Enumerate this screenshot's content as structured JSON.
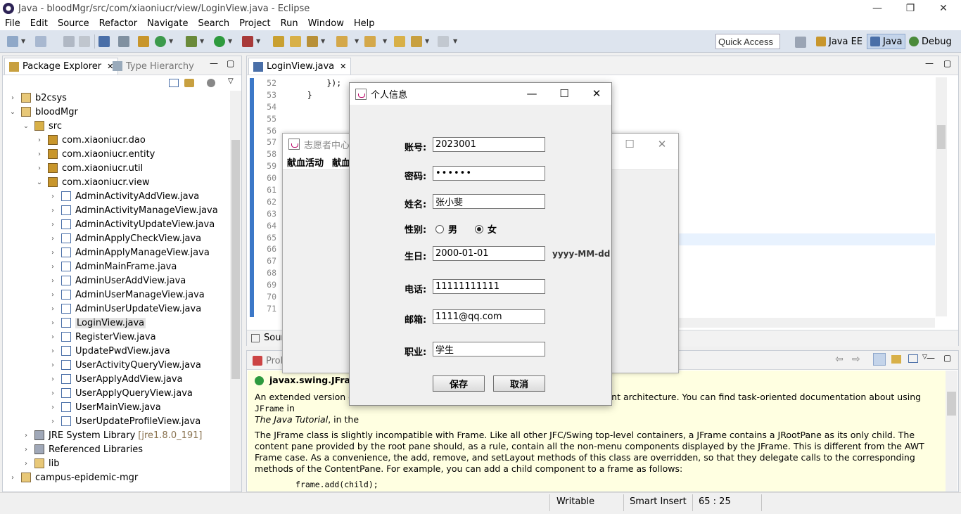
{
  "window": {
    "title": "Java - bloodMgr/src/com/xiaoniucr/view/LoginView.java - Eclipse",
    "minimize": "—",
    "restore": "❐",
    "close": "✕"
  },
  "menubar": [
    "File",
    "Edit",
    "Source",
    "Refactor",
    "Navigate",
    "Search",
    "Project",
    "Run",
    "Window",
    "Help"
  ],
  "toolbar": {
    "quick_access": "Quick Access",
    "perspectives": [
      {
        "label": "Java EE",
        "icon": "java-ee-perspective-icon"
      },
      {
        "label": "Java",
        "icon": "java-perspective-icon"
      },
      {
        "label": "Debug",
        "icon": "debug-perspective-icon"
      }
    ]
  },
  "package_explorer": {
    "tab_label": "Package Explorer",
    "tab2_label": "Type Hierarchy",
    "tree": [
      {
        "label": "b2csys",
        "arrow": "›",
        "icon": "project-icon",
        "depth": 0
      },
      {
        "label": "bloodMgr",
        "arrow": "⌄",
        "icon": "project-icon",
        "depth": 0
      },
      {
        "label": "src",
        "arrow": "⌄",
        "icon": "source-folder-icon",
        "depth": 1
      },
      {
        "label": "com.xiaoniucr.dao",
        "arrow": "›",
        "icon": "package-icon",
        "depth": 2
      },
      {
        "label": "com.xiaoniucr.entity",
        "arrow": "›",
        "icon": "package-icon",
        "depth": 2
      },
      {
        "label": "com.xiaoniucr.util",
        "arrow": "›",
        "icon": "package-icon",
        "depth": 2
      },
      {
        "label": "com.xiaoniucr.view",
        "arrow": "⌄",
        "icon": "package-icon",
        "depth": 2
      },
      {
        "label": "AdminActivityAddView.java",
        "arrow": "›",
        "icon": "java-file-icon",
        "depth": 3
      },
      {
        "label": "AdminActivityManageView.java",
        "arrow": "›",
        "icon": "java-file-icon",
        "depth": 3
      },
      {
        "label": "AdminActivityUpdateView.java",
        "arrow": "›",
        "icon": "java-file-icon",
        "depth": 3
      },
      {
        "label": "AdminApplyCheckView.java",
        "arrow": "›",
        "icon": "java-file-icon",
        "depth": 3
      },
      {
        "label": "AdminApplyManageView.java",
        "arrow": "›",
        "icon": "java-file-icon",
        "depth": 3
      },
      {
        "label": "AdminMainFrame.java",
        "arrow": "›",
        "icon": "java-file-icon",
        "depth": 3
      },
      {
        "label": "AdminUserAddView.java",
        "arrow": "›",
        "icon": "java-file-icon",
        "depth": 3
      },
      {
        "label": "AdminUserManageView.java",
        "arrow": "›",
        "icon": "java-file-icon",
        "depth": 3
      },
      {
        "label": "AdminUserUpdateView.java",
        "arrow": "›",
        "icon": "java-file-icon",
        "depth": 3
      },
      {
        "label": "LoginView.java",
        "arrow": "›",
        "icon": "java-file-icon",
        "depth": 3,
        "selected": true
      },
      {
        "label": "RegisterView.java",
        "arrow": "›",
        "icon": "java-file-icon",
        "depth": 3
      },
      {
        "label": "UpdatePwdView.java",
        "arrow": "›",
        "icon": "java-file-icon",
        "depth": 3
      },
      {
        "label": "UserActivityQueryView.java",
        "arrow": "›",
        "icon": "java-file-icon",
        "depth": 3
      },
      {
        "label": "UserApplyAddView.java",
        "arrow": "›",
        "icon": "java-file-icon",
        "depth": 3
      },
      {
        "label": "UserApplyQueryView.java",
        "arrow": "›",
        "icon": "java-file-icon",
        "depth": 3
      },
      {
        "label": "UserMainView.java",
        "arrow": "›",
        "icon": "java-file-icon",
        "depth": 3
      },
      {
        "label": "UserUpdateProfileView.java",
        "arrow": "›",
        "icon": "java-file-icon",
        "depth": 3
      },
      {
        "label": "JRE System Library",
        "arrow": "›",
        "icon": "library-icon",
        "depth": 1,
        "decoration": "[jre1.8.0_191]"
      },
      {
        "label": "Referenced Libraries",
        "arrow": "›",
        "icon": "library-icon",
        "depth": 1
      },
      {
        "label": "lib",
        "arrow": "›",
        "icon": "folder-icon",
        "depth": 1
      },
      {
        "label": "campus-epidemic-mgr",
        "arrow": "›",
        "icon": "project-icon",
        "depth": 0
      }
    ]
  },
  "editor": {
    "tab_label": "LoginView.java",
    "line_numbers": [
      "52",
      "53",
      "54",
      "55",
      "56",
      "57",
      "58",
      "59",
      "60",
      "61",
      "62",
      "63",
      "64",
      "65",
      "66",
      "67",
      "68",
      "69",
      "70",
      "71"
    ],
    "code_lines": [
      "        });",
      "    }",
      "",
      "",
      "",
      "",
      "",
      "",
      "",
      "",
      "",
      "",
      "",
      "",
      "",
      "",
      "",
      "",
      "",
      ""
    ],
    "bottom_tab_label": "Sour"
  },
  "bottom_panel": {
    "tab_label": "Prob",
    "javadoc_title": "javax.swing.JFrame",
    "para1_a": "An extended version of",
    "para1_b": "nt architecture. You can find task-oriented documentation about using",
    "para1_code": "JFrame",
    "para1_c": "in",
    "para1_tutorial": "The Java Tutorial",
    "para1_d": ", in the",
    "para2": "The JFrame class is slightly incompatible with Frame. Like all other JFC/Swing top-level containers, a JFrame contains a JRootPane as its only child. The content pane provided by the root pane should, as a rule, contain all the non-menu components displayed by the JFrame. This is different from the AWT Frame case. As a convenience, the add, remove, and setLayout methods of this class are overridden, so that they delegate calls to the corresponding methods of the ContentPane. For example, you can add a child component to a frame as follows:",
    "code_sample": "frame.add(child);"
  },
  "statusbar": {
    "writable": "Writable",
    "insert_mode": "Smart Insert",
    "position": "65 : 25"
  },
  "volunteer_window": {
    "title": "志愿者中心",
    "menus": [
      "献血活动",
      "献血"
    ]
  },
  "info_dialog": {
    "title": "个人信息",
    "fields": {
      "account_label": "账号:",
      "account_value": "2023001",
      "password_label": "密码:",
      "password_value": "••••••",
      "name_label": "姓名:",
      "name_value": "张小斐",
      "gender_label": "性别:",
      "gender_male": "男",
      "gender_female": "女",
      "gender_selected": "女",
      "birth_label": "生日:",
      "birth_value": "2000-01-01",
      "birth_hint": "yyyy-MM-dd",
      "phone_label": "电话:",
      "phone_value": "11111111111",
      "email_label": "邮箱:",
      "email_value": "1111@qq.com",
      "job_label": "职业:",
      "job_value": "学生"
    },
    "save_button": "保存",
    "cancel_button": "取消"
  },
  "colors": {
    "toolbar_bg": "#dde4ee",
    "javadoc_bg": "#ffffe1",
    "gutter_marker": "#3c78c8"
  }
}
